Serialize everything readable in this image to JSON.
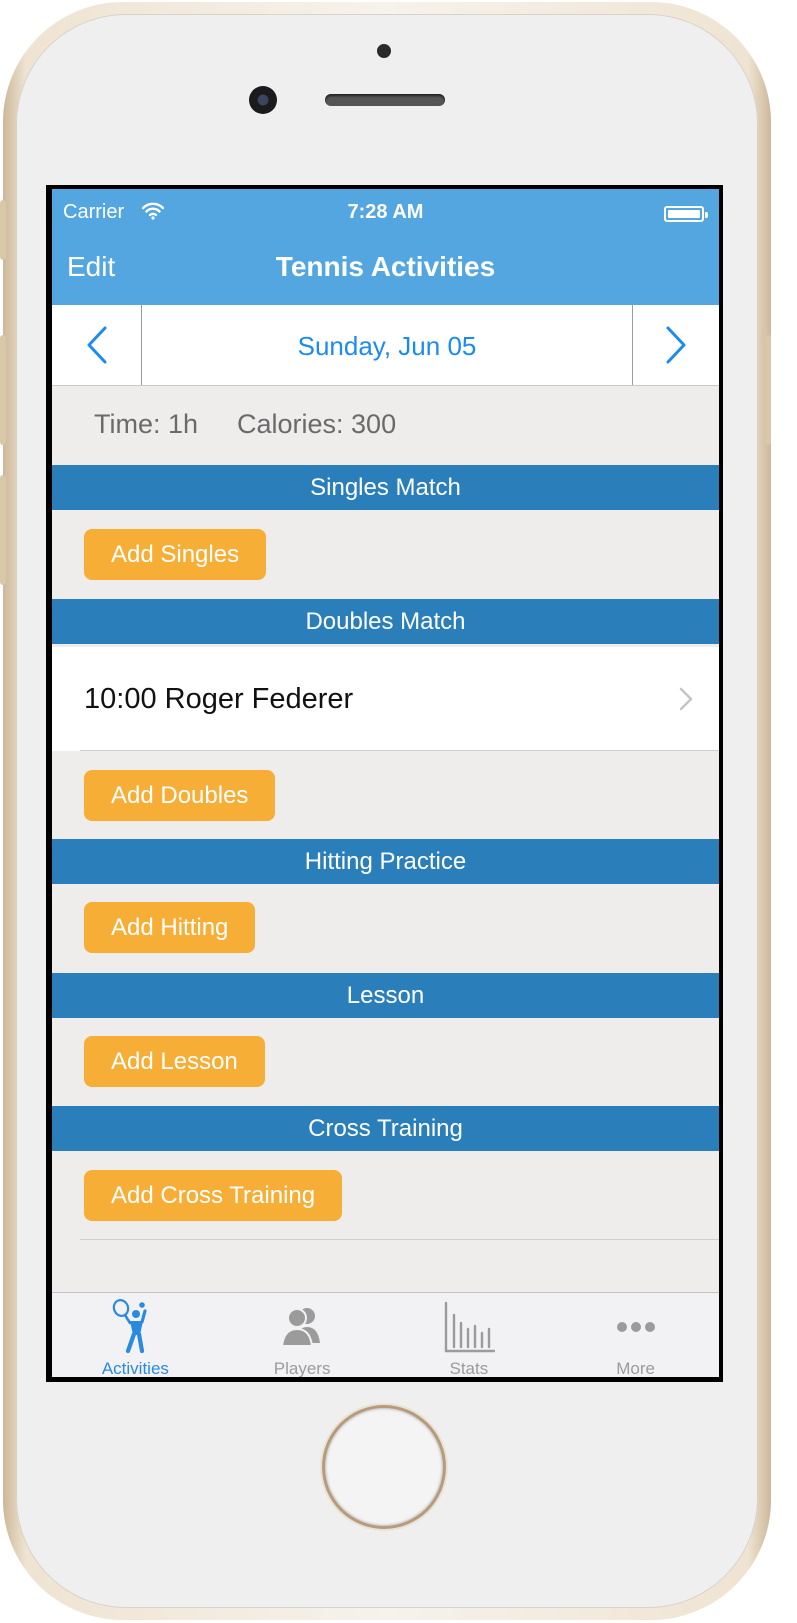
{
  "status_bar": {
    "carrier": "Carrier",
    "time": "7:28 AM"
  },
  "nav": {
    "edit_label": "Edit",
    "title": "Tennis Activities"
  },
  "date_nav": {
    "date": "Sunday, Jun 05"
  },
  "summary": {
    "time": "Time: 1h",
    "calories": "Calories: 300"
  },
  "sections": [
    {
      "title": "Singles Match",
      "button": "Add Singles"
    },
    {
      "title": "Doubles Match",
      "button": "Add Doubles",
      "rows": [
        {
          "label": "10:00 Roger Federer"
        }
      ]
    },
    {
      "title": "Hitting Practice",
      "button": "Add Hitting"
    },
    {
      "title": "Lesson",
      "button": "Add Lesson"
    },
    {
      "title": "Cross Training",
      "button": "Add Cross Training"
    }
  ],
  "tabs": [
    {
      "label": "Activities",
      "icon": "tennis-player-icon",
      "active": true
    },
    {
      "label": "Players",
      "icon": "players-icon",
      "active": false
    },
    {
      "label": "Stats",
      "icon": "stats-icon",
      "active": false
    },
    {
      "label": "More",
      "icon": "more-icon",
      "active": false
    }
  ],
  "colors": {
    "nav_bar": "#53a6e0",
    "section_header": "#2a7fbb",
    "add_button": "#f6ae36",
    "accent": "#1a8bf0",
    "background": "#efedec"
  }
}
